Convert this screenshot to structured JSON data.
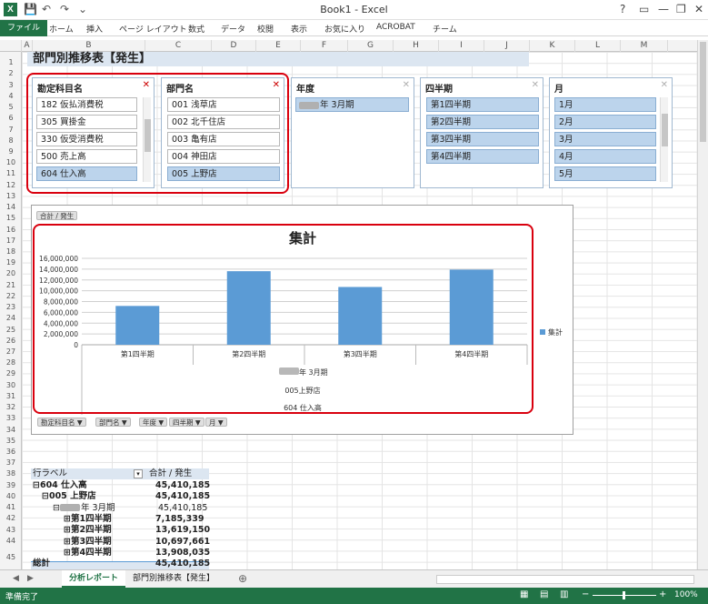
{
  "window": {
    "title": "Book1 - Excel",
    "app_icon": "X",
    "qat_icons": [
      "save-icon",
      "undo-icon",
      "redo-icon"
    ],
    "controls": [
      "?",
      "▭",
      "—",
      "❐",
      "✕"
    ]
  },
  "ribbon_tabs": [
    "ファイル",
    "ホーム",
    "挿入",
    "ページ レイアウト",
    "数式",
    "データ",
    "校閲",
    "表示",
    "お気に入り",
    "ACROBAT",
    "チーム"
  ],
  "columns": [
    "A",
    "B",
    "C",
    "D",
    "E",
    "F",
    "G",
    "H",
    "I",
    "J",
    "K",
    "L",
    "M"
  ],
  "rows": [
    "1",
    "2",
    "3",
    "4",
    "5",
    "6",
    "7",
    "8",
    "9",
    "10",
    "11",
    "12",
    "13",
    "14",
    "15",
    "16",
    "17",
    "18",
    "19",
    "20",
    "21",
    "22",
    "23",
    "24",
    "25",
    "26",
    "27",
    "28",
    "29",
    "30",
    "31",
    "32",
    "33",
    "34",
    "35",
    "36",
    "37",
    "38",
    "39",
    "40",
    "41",
    "42",
    "43",
    "44",
    "45"
  ],
  "sheet_title": "部門別推移表【発生】",
  "slicers": {
    "account": {
      "header": "勘定科目名",
      "items": [
        "182 仮払消費税",
        "305 買掛金",
        "330 仮受消費税",
        "500 売上高",
        "604 仕入高"
      ],
      "selected": "604 仕入高"
    },
    "dept": {
      "header": "部門名",
      "items": [
        "001 浅草店",
        "002 北千住店",
        "003 亀有店",
        "004 神田店",
        "005 上野店"
      ],
      "selected": "005 上野店"
    },
    "year": {
      "header": "年度",
      "items": [
        "年 3月期"
      ]
    },
    "quarter": {
      "header": "四半期",
      "items": [
        "第1四半期",
        "第2四半期",
        "第3四半期",
        "第4四半期"
      ]
    },
    "month": {
      "header": "月",
      "items": [
        "1月",
        "2月",
        "3月",
        "4月",
        "5月"
      ]
    }
  },
  "chart_field_button": "合計 / 発生",
  "chart_data": {
    "type": "bar",
    "title": "集計",
    "categories": [
      "第1四半期",
      "第2四半期",
      "第3四半期",
      "第4四半期"
    ],
    "series": [
      {
        "name": "集計",
        "values": [
          7185339,
          13619150,
          10697661,
          13908035
        ],
        "color": "#5b9bd5"
      }
    ],
    "ylim": [
      0,
      16000000
    ],
    "yticks": [
      "16,000,000",
      "14,000,000",
      "12,000,000",
      "10,000,000",
      "8,000,000",
      "6,000,000",
      "4,000,000",
      "2,000,000",
      "0"
    ],
    "axis_group_labels": [
      "年 3月期",
      "005上野店",
      "604 仕入高"
    ],
    "legend": "right",
    "grid": true
  },
  "chart_filter_buttons": [
    "勘定科目名",
    "部門名",
    "年度",
    "四半期",
    "月"
  ],
  "pivot": {
    "header_label": "行ラベル",
    "header_value": "合計 / 発生",
    "rows": [
      {
        "label": "⊟604 仕入高",
        "value": "45,410,185",
        "bold": true,
        "indent": 0
      },
      {
        "label": "⊟005 上野店",
        "value": "45,410,185",
        "bold": true,
        "indent": 1
      },
      {
        "label": "⊟年 3月期",
        "value": "45,410,185",
        "bold": false,
        "indent": 2
      },
      {
        "label": "⊞第1四半期",
        "value": "7,185,339",
        "bold": true,
        "indent": 3
      },
      {
        "label": "⊞第2四半期",
        "value": "13,619,150",
        "bold": true,
        "indent": 3
      },
      {
        "label": "⊞第3四半期",
        "value": "10,697,661",
        "bold": true,
        "indent": 3
      },
      {
        "label": "⊞第4四半期",
        "value": "13,908,035",
        "bold": true,
        "indent": 3
      }
    ],
    "total_label": "総計",
    "total_value": "45,410,185"
  },
  "sheet_tabs": [
    "分析レポート",
    "部門別推移表【発生】"
  ],
  "active_tab": "分析レポート",
  "status": {
    "ready": "準備完了",
    "zoom": "100%"
  },
  "colors": {
    "excel_green": "#217346",
    "bar": "#5b9bd5",
    "selection": "#bcd4ec",
    "highlight": "#d9000e"
  }
}
